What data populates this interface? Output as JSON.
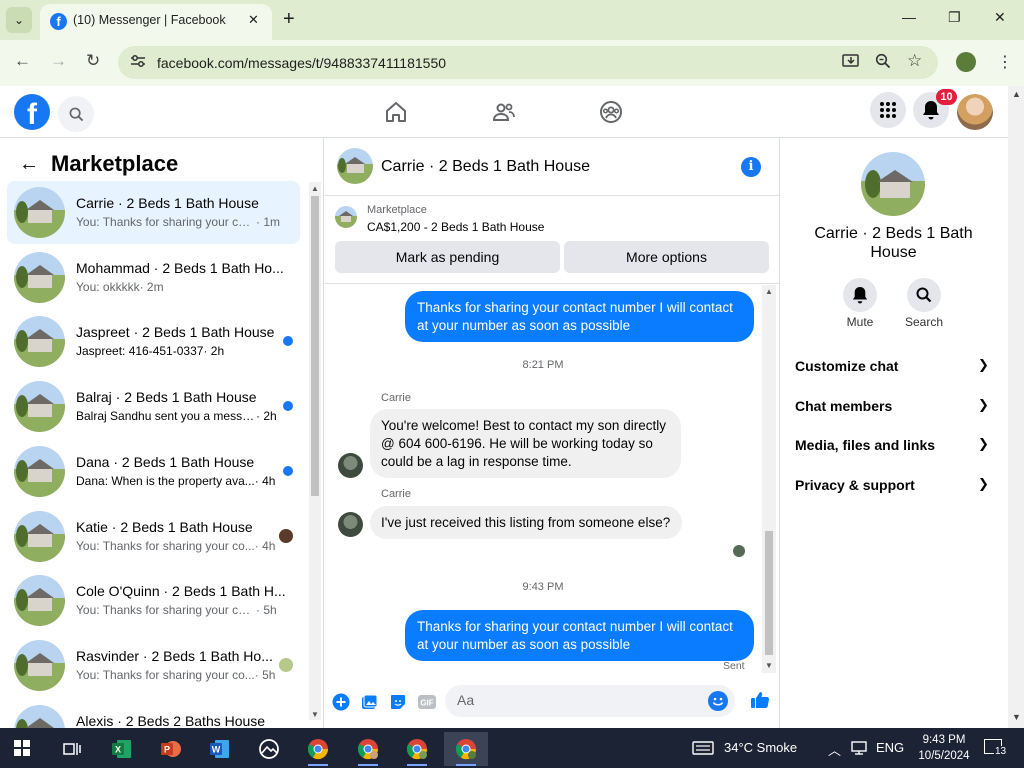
{
  "browser": {
    "tab_title": "(10) Messenger | Facebook",
    "tab_close": "✕",
    "new_tab": "+",
    "url": "facebook.com/messages/t/9488337411181550",
    "window_controls": [
      "—",
      "❐",
      "✕"
    ]
  },
  "fb_nav": {
    "notification_count": "10"
  },
  "marketplace": {
    "title": "Marketplace",
    "conversations": [
      {
        "name": "Carrie · 2 Beds 1 Bath House",
        "preview": "You: Thanks for sharing your cont...",
        "time": "· 1m",
        "indicator": "none",
        "active": true
      },
      {
        "name": "Mohammad · 2 Beds 1 Bath Ho...",
        "preview": "You: okkkkk",
        "time": "· 2m",
        "indicator": "none"
      },
      {
        "name": "Jaspreet · 2 Beds 1 Bath House",
        "preview": "Jaspreet: 416-451-0337",
        "time": "· 2h",
        "indicator": "unread"
      },
      {
        "name": "Balraj · 2 Beds 1 Bath House",
        "preview": "Balraj Sandhu sent you a messa...",
        "time": "· 2h",
        "indicator": "unread"
      },
      {
        "name": "Dana · 2 Beds 1 Bath House",
        "preview": "Dana: When is the property ava...",
        "time": "· 4h",
        "indicator": "unread"
      },
      {
        "name": "Katie · 2 Beds 1 Bath House",
        "preview": "You: Thanks for sharing your co...",
        "time": "· 4h",
        "indicator": "avatar"
      },
      {
        "name": "Cole O'Quinn · 2 Beds 1 Bath H...",
        "preview": "You: Thanks for sharing your conta...",
        "time": "· 5h",
        "indicator": "none"
      },
      {
        "name": "Rasvinder · 2 Beds 1 Bath Ho...",
        "preview": "You: Thanks for sharing your co...",
        "time": "· 5h",
        "indicator": "avatar"
      },
      {
        "name": "Alexis · 2 Beds 2 Baths House",
        "preview": "",
        "time": "",
        "indicator": "none"
      }
    ]
  },
  "chat": {
    "header_name": "Carrie · 2 Beds 1 Bath House",
    "listing": {
      "label": "Marketplace",
      "price_title": "CA$1,200 - 2 Beds 1 Bath House",
      "mark_pending": "Mark as pending",
      "more_options": "More options"
    },
    "messages": {
      "out_1": "Thanks for sharing your contact number I will contact at your number as soon as possible",
      "time_1": "8:21 PM",
      "sender_1": "Carrie",
      "in_1": "You're welcome!  Best to contact my son directly @ 604 600-6196.  He will be working today so could be a lag in response time.",
      "sender_2": "Carrie",
      "in_2": "I've just received this listing from someone else?",
      "time_2": "9:43 PM",
      "out_2": "Thanks for sharing your contact number I will contact at your number as soon as possible",
      "status": "Sent"
    },
    "composer_placeholder": "Aa"
  },
  "right_panel": {
    "name": "Carrie · 2 Beds 1 Bath House",
    "mute_label": "Mute",
    "search_label": "Search",
    "menu": [
      "Customize chat",
      "Chat members",
      "Media, files and links",
      "Privacy & support"
    ]
  },
  "taskbar": {
    "weather": "34°C  Smoke",
    "language": "ENG",
    "time": "9:43 PM",
    "date": "10/5/2024",
    "notifications": "13"
  }
}
